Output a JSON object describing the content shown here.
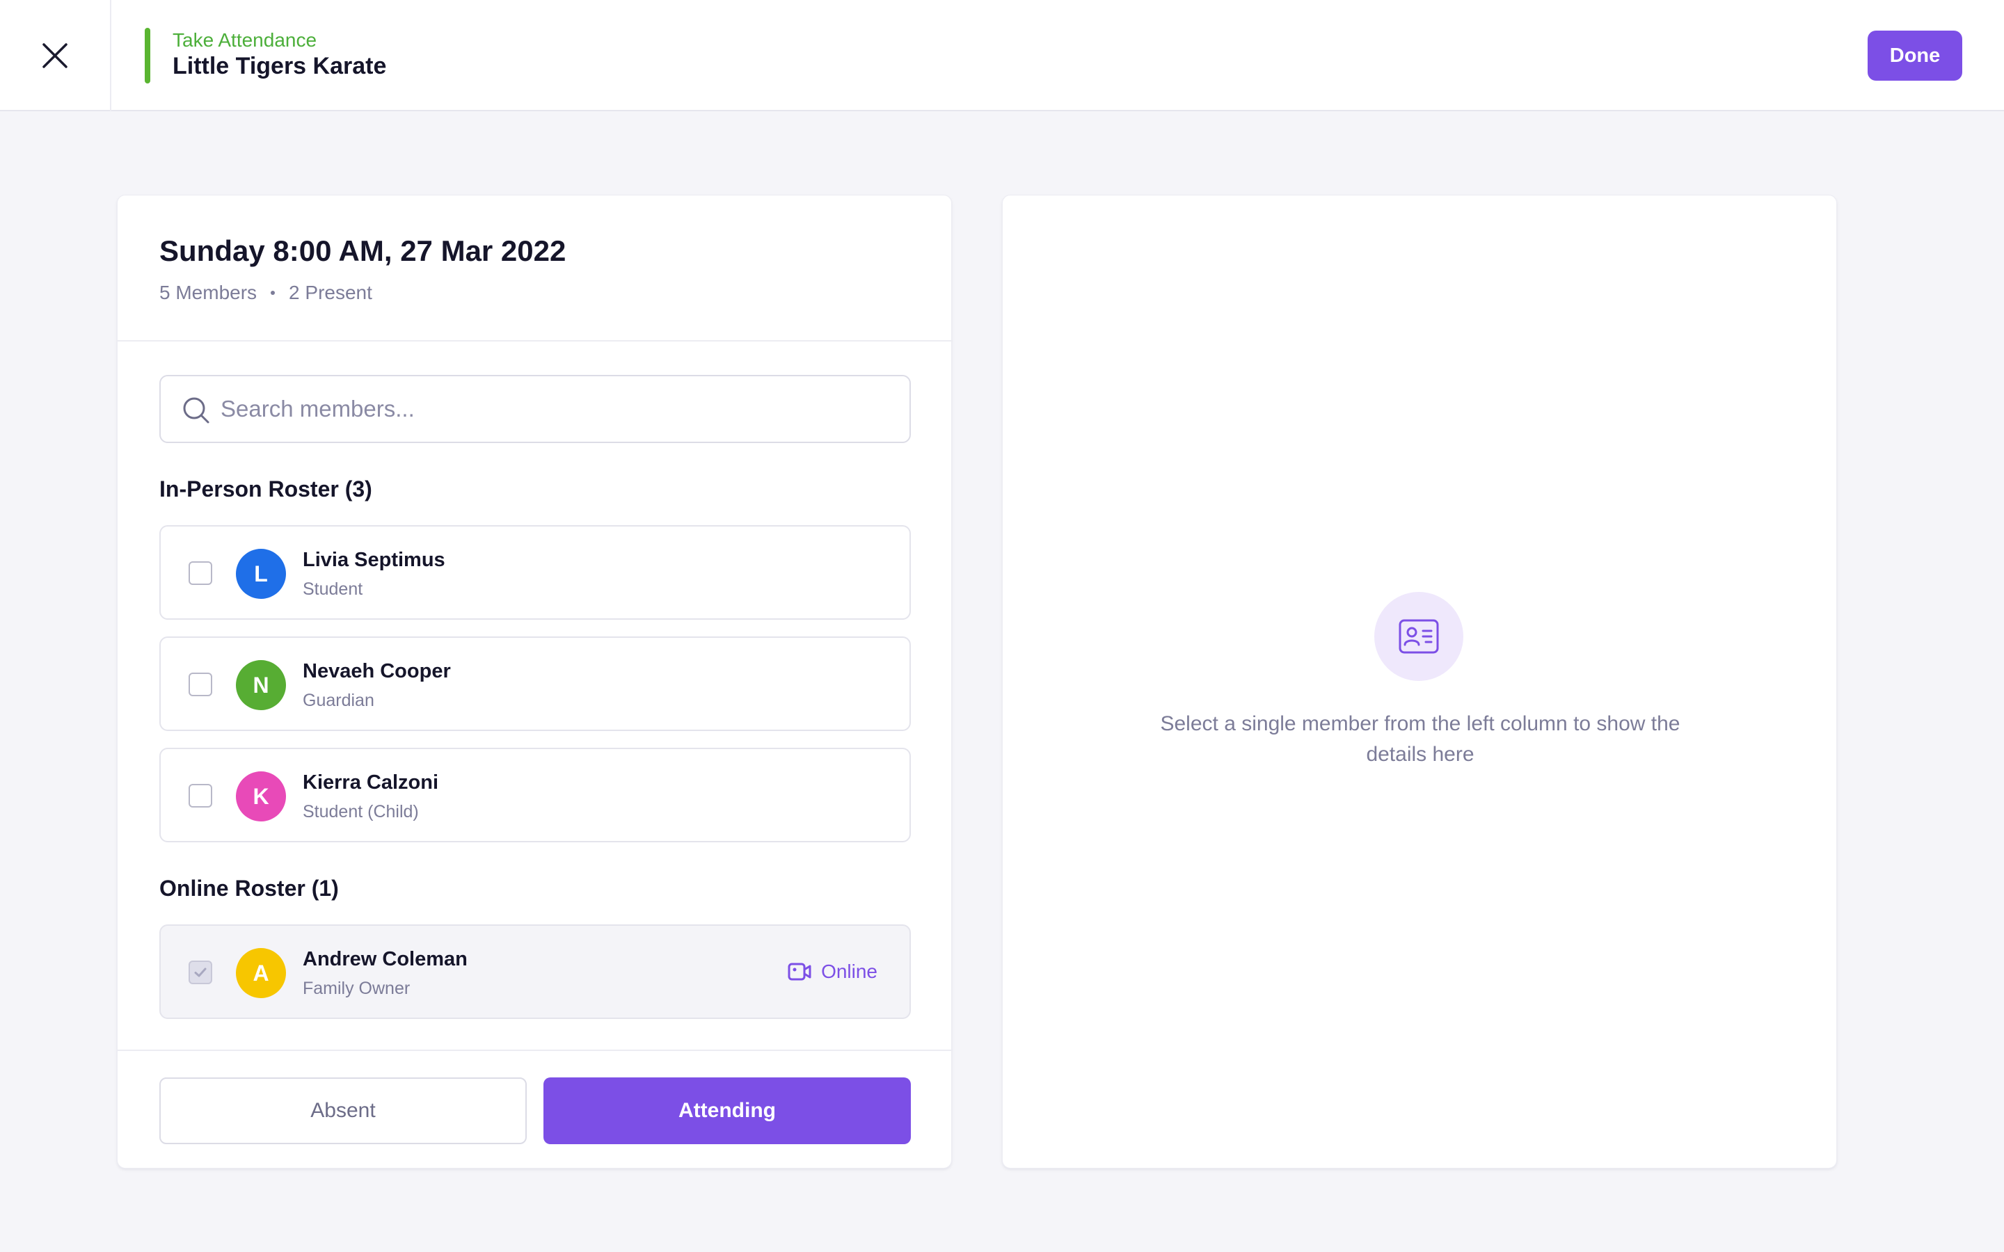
{
  "header": {
    "subtitle": "Take Attendance",
    "title": "Little Tigers Karate",
    "done_label": "Done"
  },
  "session": {
    "title": "Sunday 8:00 AM, 27 Mar 2022",
    "members_count": "5 Members",
    "present_count": "2 Present"
  },
  "search": {
    "placeholder": "Search members...",
    "value": ""
  },
  "in_person_roster": {
    "heading": "In-Person Roster (3)",
    "members": [
      {
        "initial": "L",
        "name": "Livia Septimus",
        "role": "Student",
        "avatar_color": "#1f6fe8",
        "checked": false
      },
      {
        "initial": "N",
        "name": "Nevaeh Cooper",
        "role": "Guardian",
        "avatar_color": "#57ad33",
        "checked": false
      },
      {
        "initial": "K",
        "name": "Kierra Calzoni",
        "role": "Student (Child)",
        "avatar_color": "#e84ab8",
        "checked": false
      }
    ]
  },
  "online_roster": {
    "heading": "Online Roster (1)",
    "members": [
      {
        "initial": "A",
        "name": "Andrew Coleman",
        "role": "Family Owner",
        "avatar_color": "#f7c600",
        "checked": true,
        "badge": "Online",
        "badge_icon": "video-camera-icon"
      }
    ]
  },
  "actions": {
    "absent_label": "Absent",
    "attending_label": "Attending"
  },
  "details_panel": {
    "empty_icon": "contact-card-icon",
    "empty_text": "Select a single member from the left column to show the details here"
  },
  "colors": {
    "accent": "#7c4fe6",
    "brand_green": "#5ab531",
    "background": "#f5f5f9"
  }
}
